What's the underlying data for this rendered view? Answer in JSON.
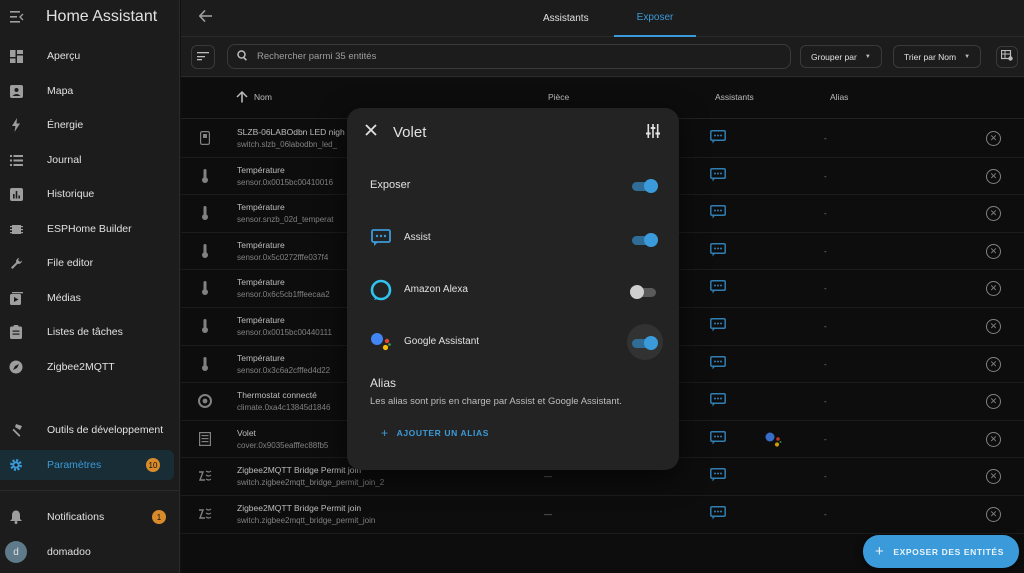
{
  "sidebar": {
    "title": "Home Assistant",
    "items": [
      {
        "label": "Aperçu",
        "icon": "dashboard-icon"
      },
      {
        "label": "Mapa",
        "icon": "map-icon"
      },
      {
        "label": "Énergie",
        "icon": "lightning-icon"
      },
      {
        "label": "Journal",
        "icon": "list-icon"
      },
      {
        "label": "Historique",
        "icon": "chart-box-icon"
      },
      {
        "label": "ESPHome Builder",
        "icon": "chip-icon"
      },
      {
        "label": "File editor",
        "icon": "wrench-icon"
      },
      {
        "label": "Médias",
        "icon": "play-box-icon"
      },
      {
        "label": "Listes de tâches",
        "icon": "clipboard-list-icon"
      },
      {
        "label": "Zigbee2MQTT",
        "icon": "compass-icon"
      }
    ],
    "dev_tools": "Outils de développement",
    "settings": {
      "label": "Paramètres",
      "badge": "10"
    },
    "notifications": {
      "label": "Notifications",
      "badge": "1"
    },
    "user": {
      "initial": "d",
      "name": "domadoo"
    }
  },
  "tabs": {
    "assistants": "Assistants",
    "expose": "Exposer"
  },
  "toolbar": {
    "search_placeholder": "Rechercher parmi 35 entités",
    "group_by": "Grouper par",
    "sort_by": "Trier par Nom"
  },
  "table": {
    "headers": {
      "name": "Nom",
      "area": "Pièce",
      "assistants": "Assistants",
      "aliases": "Alias"
    },
    "rows": [
      {
        "name": "SLZB-06LABOdbn LED nigh",
        "id": "switch.slzb_06labodbn_led_",
        "area": "",
        "alias": "-",
        "icon": "switch-icon",
        "google": false
      },
      {
        "name": "Température",
        "id": "sensor.0x0015bc00410016",
        "area": "",
        "alias": "-",
        "icon": "thermometer-icon",
        "google": false
      },
      {
        "name": "Température",
        "id": "sensor.snzb_02d_temperat",
        "area": "",
        "alias": "-",
        "icon": "thermometer-icon",
        "google": false
      },
      {
        "name": "Température",
        "id": "sensor.0x5c0272fffe037f4",
        "area": "",
        "alias": "-",
        "icon": "thermometer-icon",
        "google": false
      },
      {
        "name": "Température",
        "id": "sensor.0x6c5cb1fffeecaa2",
        "area": "",
        "alias": "-",
        "icon": "thermometer-icon",
        "google": false
      },
      {
        "name": "Température",
        "id": "sensor.0x0015bc00440111",
        "area": "",
        "alias": "-",
        "icon": "thermometer-icon",
        "google": false
      },
      {
        "name": "Température",
        "id": "sensor.0x3c6a2cfffed4d22",
        "area": "",
        "alias": "-",
        "icon": "thermometer-icon",
        "google": false
      },
      {
        "name": "Thermostat connecté",
        "id": "climate.0xa4c13845d1846",
        "area": "",
        "alias": "-",
        "icon": "thermostat-icon",
        "google": false
      },
      {
        "name": "Volet",
        "id": "cover.0x9035eafffec88fb5",
        "area": "",
        "alias": "-",
        "icon": "blinds-icon",
        "google": true
      },
      {
        "name": "Zigbee2MQTT Bridge Permit join",
        "id": "switch.zigbee2mqtt_bridge_permit_join_2",
        "area": "—",
        "alias": "-",
        "icon": "zigbee-icon",
        "google": false
      },
      {
        "name": "Zigbee2MQTT Bridge Permit join",
        "id": "switch.zigbee2mqtt_bridge_permit_join",
        "area": "—",
        "alias": "-",
        "icon": "zigbee-icon",
        "google": false
      }
    ]
  },
  "dialog": {
    "title": "Volet",
    "expose_label": "Exposer",
    "expose_on": true,
    "assistants": [
      {
        "label": "Assist",
        "on": true,
        "icon": "assist-chat-icon"
      },
      {
        "label": "Amazon Alexa",
        "on": false,
        "icon": "alexa-icon"
      },
      {
        "label": "Google Assistant",
        "on": true,
        "icon": "google-assistant-icon"
      }
    ],
    "alias_title": "Alias",
    "alias_description": "Les alias sont pris en charge par Assist et Google Assistant.",
    "add_alias": "AJOUTER UN ALIAS"
  },
  "fab": {
    "label": "EXPOSER DES ENTITÉS"
  },
  "colors": {
    "accent": "#3b9ad9",
    "badge": "#d98b2b",
    "background": "#111111",
    "surface": "#1c1c1c",
    "dialog": "#232323"
  }
}
